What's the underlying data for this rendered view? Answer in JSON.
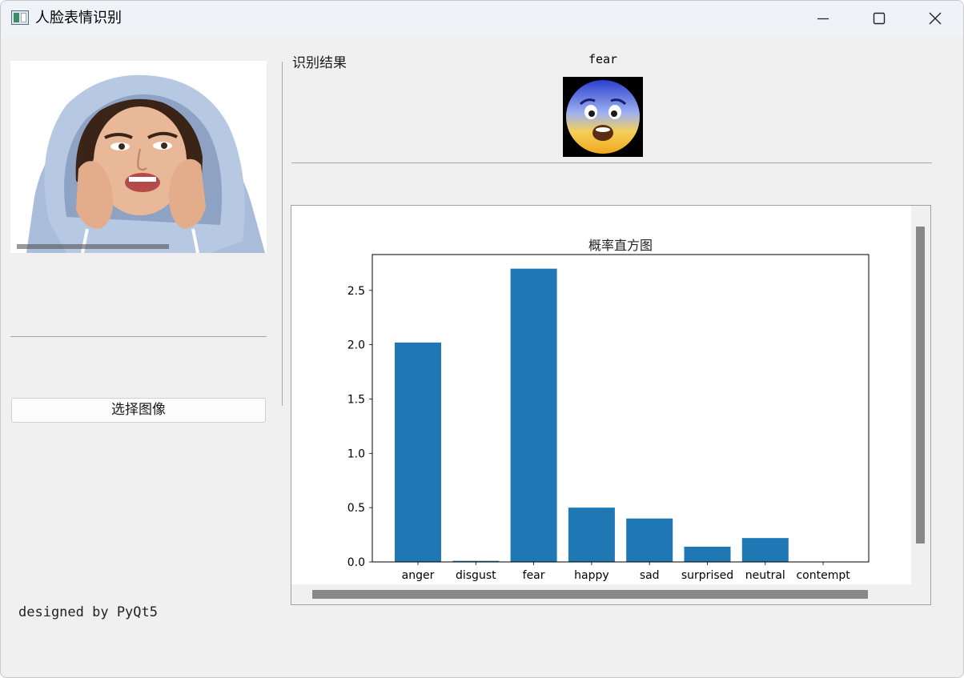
{
  "window": {
    "title": "人脸表情识别",
    "minimize_icon": "minimize-icon",
    "maximize_icon": "maximize-icon",
    "close_icon": "close-icon"
  },
  "left_panel": {
    "select_button_label": "选择图像",
    "footer_text": "designed by PyQt5"
  },
  "result": {
    "section_label": "识别结果",
    "emotion": "fear",
    "emoji_icon": "fearful-face-icon"
  },
  "chart_data": {
    "type": "bar",
    "title": "概率直方图",
    "categories": [
      "anger",
      "disgust",
      "fear",
      "happy",
      "sad",
      "surprised",
      "neutral",
      "contempt"
    ],
    "values": [
      2.02,
      0.01,
      2.7,
      0.5,
      0.4,
      0.14,
      0.22,
      0.0
    ],
    "yticks": [
      "0.0",
      "0.5",
      "1.0",
      "1.5",
      "2.0",
      "2.5"
    ],
    "ylim": [
      0,
      2.83
    ],
    "bar_color": "#1f77b4",
    "grid": false,
    "xlabel": "",
    "ylabel": ""
  }
}
